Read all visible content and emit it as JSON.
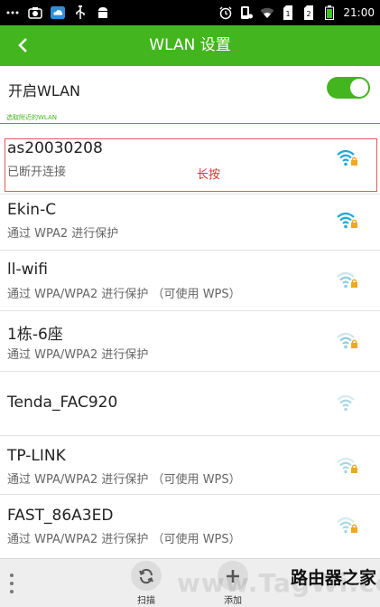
{
  "status_bar": {
    "time": "21:00",
    "left_icons": [
      "more-dots-icon",
      "screenshot-icon",
      "cloud-icon",
      "usb-icon",
      "android-icon"
    ],
    "right_icons": [
      "alarm-icon",
      "phone-icon",
      "wifi-status-icon",
      "sim1-icon",
      "sim2-icon",
      "battery-icon"
    ]
  },
  "app_bar": {
    "title": "WLAN 设置",
    "back_icon": "chevron-left-icon",
    "color": "#43b51e"
  },
  "wlan_toggle": {
    "label": "开启WLAN",
    "enabled": true
  },
  "section": {
    "label": "选取附近的WLAN"
  },
  "networks": [
    {
      "name": "as20030208",
      "status": "已断开连接",
      "signal": "strong",
      "locked": true,
      "color": "#1fa9d6"
    },
    {
      "name": "Ekin-C",
      "status": "通过 WPA2 进行保护",
      "signal": "strong",
      "locked": true,
      "color": "#1fa9d6"
    },
    {
      "name": "ll-wifi",
      "status": "通过 WPA/WPA2 进行保护 （可使用 WPS）",
      "signal": "medium",
      "locked": true,
      "color": "#8fcddf"
    },
    {
      "name": "1栋-6座",
      "status": "通过 WPA/WPA2 进行保护",
      "signal": "medium",
      "locked": true,
      "color": "#8fcddf"
    },
    {
      "name": "Tenda_FAC920",
      "status": "",
      "signal": "weak",
      "locked": false,
      "color": "#a9d8e6"
    },
    {
      "name": "TP-LINK",
      "status": "通过 WPA/WPA2 进行保护 （可使用 WPS）",
      "signal": "weak",
      "locked": true,
      "color": "#a9d8e6"
    },
    {
      "name": "FAST_86A3ED",
      "status": "通过 WPA/WPA2 进行保护 （可使用 WPS）",
      "signal": "weak",
      "locked": true,
      "color": "#a9d8e6"
    }
  ],
  "annotation": {
    "text": "长按",
    "color": "#e53030"
  },
  "bottom_bar": {
    "scan_label": "扫描",
    "add_label": "添加",
    "scan_icon": "refresh-icon",
    "add_icon": "plus-icon",
    "menu_icon": "overflow-menu-icon"
  },
  "watermark": {
    "site": "www.TagWi.com",
    "brand": "路由器之家"
  }
}
